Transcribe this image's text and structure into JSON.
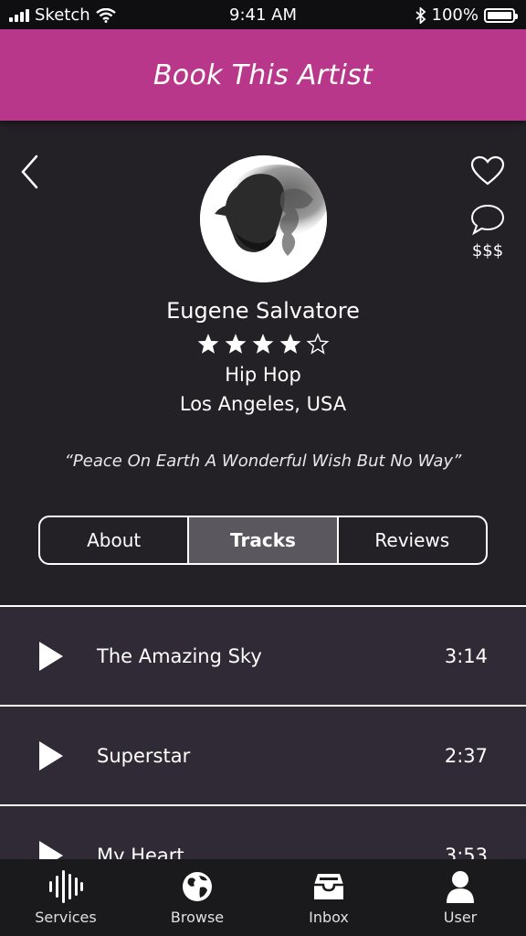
{
  "status_bar": {
    "carrier": "Sketch",
    "time": "9:41 AM",
    "battery": "100%"
  },
  "header": {
    "title": "Book This Artist"
  },
  "artist": {
    "name": "Eugene Salvatore",
    "rating": 4,
    "rating_max": 5,
    "genre": "Hip Hop",
    "location": "Los Angeles, USA",
    "quote": "“Peace On Earth A Wonderful Wish But No Way”",
    "price": "$$$"
  },
  "tabs": [
    {
      "label": "About",
      "active": false
    },
    {
      "label": "Tracks",
      "active": true
    },
    {
      "label": "Reviews",
      "active": false
    }
  ],
  "tracks": [
    {
      "title": "The Amazing Sky",
      "duration": "3:14"
    },
    {
      "title": "Superstar",
      "duration": "2:37"
    },
    {
      "title": "My Heart",
      "duration": "3:53"
    }
  ],
  "tab_bar": [
    {
      "label": "Services",
      "icon": "sound-wave-icon"
    },
    {
      "label": "Browse",
      "icon": "globe-icon"
    },
    {
      "label": "Inbox",
      "icon": "inbox-icon"
    },
    {
      "label": "User",
      "icon": "user-icon"
    }
  ],
  "colors": {
    "accent": "#b9378a",
    "background": "#232026",
    "track_row": "#302a36",
    "active_tab": "#5a575e"
  }
}
